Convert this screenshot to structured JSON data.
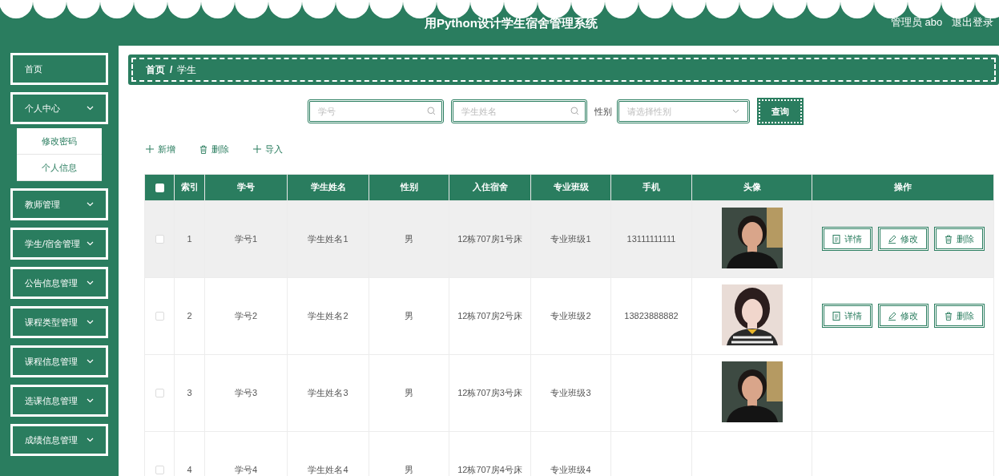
{
  "header": {
    "title": "用Python设计学生宿舍管理系统",
    "user": "管理员 abo",
    "logout": "退出登录"
  },
  "sidebar": {
    "items": [
      {
        "label": "首页",
        "kind": "link"
      },
      {
        "label": "个人中心",
        "kind": "menu",
        "children": [
          {
            "label": "修改密码"
          },
          {
            "label": "个人信息"
          }
        ]
      },
      {
        "label": "教师管理",
        "kind": "menu"
      },
      {
        "label": "学生/宿舍管理",
        "kind": "menu"
      },
      {
        "label": "公告信息管理",
        "kind": "menu"
      },
      {
        "label": "课程类型管理",
        "kind": "menu"
      },
      {
        "label": "课程信息管理",
        "kind": "menu"
      },
      {
        "label": "选课信息管理",
        "kind": "menu"
      },
      {
        "label": "成绩信息管理",
        "kind": "menu"
      }
    ]
  },
  "breadcrumb": {
    "items": [
      "首页",
      "学生"
    ],
    "separator": "/"
  },
  "search": {
    "fields": [
      {
        "placeholder": "学号"
      },
      {
        "placeholder": "学生姓名"
      }
    ],
    "gender_label": "性别",
    "gender_select": {
      "placeholder": "请选择性别"
    },
    "button": "查询"
  },
  "toolbar": [
    {
      "kind": "add",
      "label": "新增"
    },
    {
      "kind": "delete",
      "label": "删除"
    },
    {
      "kind": "add",
      "label": "导入"
    }
  ],
  "table": {
    "header_checkbox": {
      "checked": false
    },
    "columns": [
      "索引",
      "学号",
      "学生姓名",
      "性别",
      "入住宿舍",
      "专业班级",
      "手机",
      "头像",
      "操作"
    ],
    "rows": [
      {
        "checked": false,
        "highlighted": true,
        "cells": [
          "1",
          "学号1",
          "学生姓名1",
          "男",
          "12栋707房1号床",
          "专业班级1",
          "13111111111"
        ],
        "avatar": {
          "kind": "picture"
        },
        "actions": [
          {
            "kind": "detail",
            "label": "详情"
          },
          {
            "kind": "edit",
            "label": "修改"
          },
          {
            "kind": "delete",
            "label": "删除"
          }
        ]
      },
      {
        "checked": false,
        "highlighted": false,
        "cells": [
          "2",
          "学号2",
          "学生姓名2",
          "男",
          "12栋707房2号床",
          "专业班级2",
          "13823888882"
        ],
        "avatar": {
          "kind": "picture"
        },
        "actions": [
          {
            "kind": "detail",
            "label": "详情"
          },
          {
            "kind": "edit",
            "label": "修改"
          },
          {
            "kind": "delete",
            "label": "删除"
          }
        ]
      },
      {
        "checked": false,
        "highlighted": false,
        "cells": [
          "3",
          "学号3",
          "学生姓名3",
          "男",
          "12栋707房3号床",
          "专业班级3"
        ],
        "avatar": {
          "kind": "picture"
        }
      },
      {
        "checked": false,
        "highlighted": false,
        "cells": [
          "4",
          "学号4",
          "学生姓名4",
          "男",
          "12栋707房4号床",
          "专业班级4"
        ]
      }
    ]
  }
}
